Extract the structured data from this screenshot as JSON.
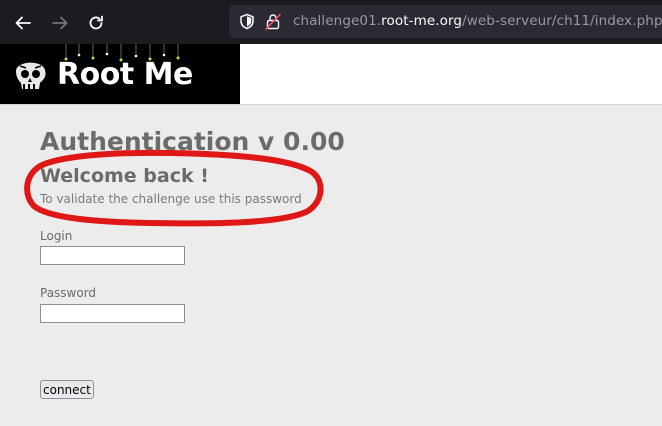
{
  "browser": {
    "url_prefix": "challenge01.",
    "url_domain": "root-me.org",
    "url_path": "/web-serveur/ch11/index.php"
  },
  "header": {
    "logo_text": "Root Me"
  },
  "main": {
    "title": "Authentication v 0.00",
    "welcome": "Welcome back !",
    "hint": "To validate the challenge use this password",
    "login_label": "Login",
    "login_value": "",
    "password_label": "Password",
    "password_value": "",
    "connect_label": "connect"
  },
  "colors": {
    "browser_toolbar": "#1c1b22",
    "url_field": "#2b2a33",
    "page_background": "#ececec",
    "annotation": "#e01717"
  }
}
